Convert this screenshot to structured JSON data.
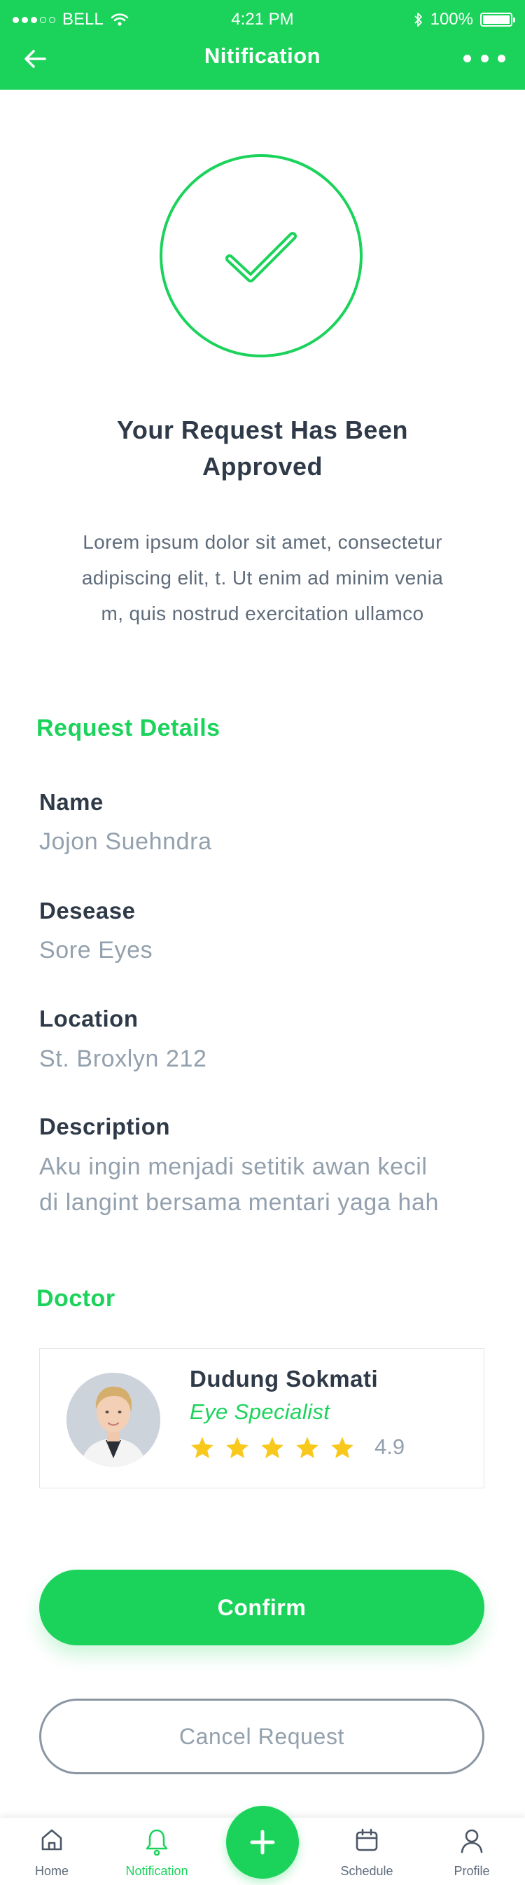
{
  "status_bar": {
    "carrier": "BELL",
    "time": "4:21 PM",
    "battery": "100%",
    "signal_dots": 5,
    "signal_filled": 3
  },
  "header": {
    "title": "Nitification",
    "back_icon": "arrow-left-icon",
    "more_icon": "more-dots-icon"
  },
  "success": {
    "icon": "check-circle-icon",
    "title_line1": "Your Request Has Been",
    "title_line2": "Approved",
    "desc_line1": "Lorem ipsum dolor sit amet, consectetur",
    "desc_line2": "adipiscing elit, t. Ut enim ad minim venia",
    "desc_line3": "m, quis nostrud exercitation ullamco"
  },
  "request_details": {
    "title": "Request Details",
    "name_label": "Name",
    "name_value": "Jojon Suehndra",
    "disease_label": "Desease",
    "disease_value": "Sore Eyes",
    "location_label": "Location",
    "location_value": "St. Broxlyn 212",
    "description_label": "Description",
    "description_line1": "Aku ingin menjadi setitik awan kecil",
    "description_line2": "di langint bersama mentari yaga hah"
  },
  "doctor": {
    "section_title": "Doctor",
    "name": "Dudung Sokmati",
    "specialty": "Eye Specialist",
    "rating": "4.9",
    "stars": 5
  },
  "buttons": {
    "confirm": "Confirm",
    "cancel": "Cancel Request"
  },
  "tabbar": {
    "home": "Home",
    "notification": "Notification",
    "schedule": "Schedule",
    "profile": "Profile",
    "add_icon": "plus-icon",
    "active": "notification"
  },
  "colors": {
    "accent": "#1bd35b",
    "text_dark": "#2f3a48",
    "text_muted": "#93a0ad",
    "star": "#f8c91c"
  }
}
